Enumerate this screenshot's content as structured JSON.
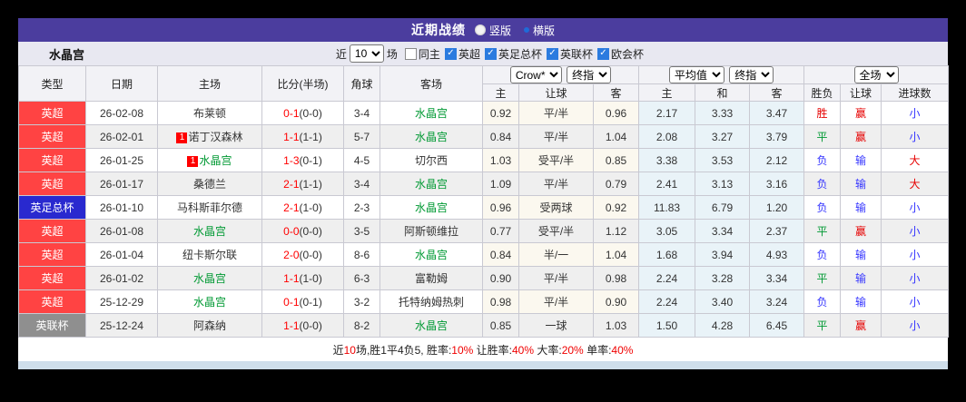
{
  "title_bar": {
    "title": "近期战绩",
    "layout_options": [
      {
        "label": "竖版",
        "selected": false
      },
      {
        "label": "横版",
        "selected": true
      }
    ]
  },
  "filter_bar": {
    "team_name": "水晶宫",
    "recent_prefix": "近",
    "recent_count": "10",
    "recent_suffix": "场",
    "checkboxes": [
      {
        "label": "同主",
        "checked": false
      },
      {
        "label": "英超",
        "checked": true
      },
      {
        "label": "英足总杯",
        "checked": true
      },
      {
        "label": "英联杯",
        "checked": true
      },
      {
        "label": "欧会杯",
        "checked": true
      }
    ]
  },
  "table": {
    "static_headers": [
      "类型",
      "日期",
      "主场",
      "比分(半场)",
      "角球",
      "客场"
    ],
    "sub_headers": [
      "主",
      "让球",
      "客",
      "主",
      "和",
      "客",
      "胜负",
      "让球",
      "进球数"
    ],
    "selects": {
      "provider": "Crow*",
      "provider_stage": "终指",
      "average": "平均值",
      "average_stage": "终指",
      "scope": "全场"
    },
    "rows": [
      {
        "league": "英超",
        "league_color": "#ff4343",
        "date": "26-02-08",
        "home": "布莱顿",
        "home_badge": "",
        "home_color": "black",
        "score": "0-1",
        "half": "(0-0)",
        "corners": "3-4",
        "away": "水晶宫",
        "away_color": "green",
        "odds_home": "0.92",
        "handicap": "平/半",
        "odds_away": "0.96",
        "avg_home": "2.17",
        "avg_draw": "3.33",
        "avg_away": "3.47",
        "result": "胜",
        "result_color": "red",
        "handicap_result": "赢",
        "handicap_result_color": "red",
        "goals": "小",
        "goals_color": "blue"
      },
      {
        "league": "英超",
        "league_color": "#ff4343",
        "date": "26-02-01",
        "home": "诺丁汉森林",
        "home_badge": "1",
        "home_color": "black",
        "score": "1-1",
        "half": "(1-1)",
        "corners": "5-7",
        "away": "水晶宫",
        "away_color": "green",
        "odds_home": "0.84",
        "handicap": "平/半",
        "odds_away": "1.04",
        "avg_home": "2.08",
        "avg_draw": "3.27",
        "avg_away": "3.79",
        "result": "平",
        "result_color": "green",
        "handicap_result": "赢",
        "handicap_result_color": "red",
        "goals": "小",
        "goals_color": "blue"
      },
      {
        "league": "英超",
        "league_color": "#ff4343",
        "date": "26-01-25",
        "home": "水晶宫",
        "home_badge": "1",
        "home_color": "green",
        "score": "1-3",
        "half": "(0-1)",
        "corners": "4-5",
        "away": "切尔西",
        "away_color": "black",
        "odds_home": "1.03",
        "handicap": "受平/半",
        "odds_away": "0.85",
        "avg_home": "3.38",
        "avg_draw": "3.53",
        "avg_away": "2.12",
        "result": "负",
        "result_color": "blue",
        "handicap_result": "输",
        "handicap_result_color": "blue",
        "goals": "大",
        "goals_color": "red"
      },
      {
        "league": "英超",
        "league_color": "#ff4343",
        "date": "26-01-17",
        "home": "桑德兰",
        "home_badge": "",
        "home_color": "black",
        "score": "2-1",
        "half": "(1-1)",
        "corners": "3-4",
        "away": "水晶宫",
        "away_color": "green",
        "odds_home": "1.09",
        "handicap": "平/半",
        "odds_away": "0.79",
        "avg_home": "2.41",
        "avg_draw": "3.13",
        "avg_away": "3.16",
        "result": "负",
        "result_color": "blue",
        "handicap_result": "输",
        "handicap_result_color": "blue",
        "goals": "大",
        "goals_color": "red"
      },
      {
        "league": "英足总杯",
        "league_color": "#2929cf",
        "date": "26-01-10",
        "home": "马科斯菲尔德",
        "home_badge": "",
        "home_color": "black",
        "score": "2-1",
        "half": "(1-0)",
        "corners": "2-3",
        "away": "水晶宫",
        "away_color": "green",
        "odds_home": "0.96",
        "handicap": "受两球",
        "odds_away": "0.92",
        "avg_home": "11.83",
        "avg_draw": "6.79",
        "avg_away": "1.20",
        "result": "负",
        "result_color": "blue",
        "handicap_result": "输",
        "handicap_result_color": "blue",
        "goals": "小",
        "goals_color": "blue"
      },
      {
        "league": "英超",
        "league_color": "#ff4343",
        "date": "26-01-08",
        "home": "水晶宫",
        "home_badge": "",
        "home_color": "green",
        "score": "0-0",
        "half": "(0-0)",
        "corners": "3-5",
        "away": "阿斯顿维拉",
        "away_color": "black",
        "odds_home": "0.77",
        "handicap": "受平/半",
        "odds_away": "1.12",
        "avg_home": "3.05",
        "avg_draw": "3.34",
        "avg_away": "2.37",
        "result": "平",
        "result_color": "green",
        "handicap_result": "赢",
        "handicap_result_color": "red",
        "goals": "小",
        "goals_color": "blue"
      },
      {
        "league": "英超",
        "league_color": "#ff4343",
        "date": "26-01-04",
        "home": "纽卡斯尔联",
        "home_badge": "",
        "home_color": "black",
        "score": "2-0",
        "half": "(0-0)",
        "corners": "8-6",
        "away": "水晶宫",
        "away_color": "green",
        "odds_home": "0.84",
        "handicap": "半/一",
        "odds_away": "1.04",
        "avg_home": "1.68",
        "avg_draw": "3.94",
        "avg_away": "4.93",
        "result": "负",
        "result_color": "blue",
        "handicap_result": "输",
        "handicap_result_color": "blue",
        "goals": "小",
        "goals_color": "blue"
      },
      {
        "league": "英超",
        "league_color": "#ff4343",
        "date": "26-01-02",
        "home": "水晶宫",
        "home_badge": "",
        "home_color": "green",
        "score": "1-1",
        "half": "(1-0)",
        "corners": "6-3",
        "away": "富勒姆",
        "away_color": "black",
        "odds_home": "0.90",
        "handicap": "平/半",
        "odds_away": "0.98",
        "avg_home": "2.24",
        "avg_draw": "3.28",
        "avg_away": "3.34",
        "result": "平",
        "result_color": "green",
        "handicap_result": "输",
        "handicap_result_color": "blue",
        "goals": "小",
        "goals_color": "blue"
      },
      {
        "league": "英超",
        "league_color": "#ff4343",
        "date": "25-12-29",
        "home": "水晶宫",
        "home_badge": "",
        "home_color": "green",
        "score": "0-1",
        "half": "(0-1)",
        "corners": "3-2",
        "away": "托特纳姆热刺",
        "away_color": "black",
        "odds_home": "0.98",
        "handicap": "平/半",
        "odds_away": "0.90",
        "avg_home": "2.24",
        "avg_draw": "3.40",
        "avg_away": "3.24",
        "result": "负",
        "result_color": "blue",
        "handicap_result": "输",
        "handicap_result_color": "blue",
        "goals": "小",
        "goals_color": "blue"
      },
      {
        "league": "英联杯",
        "league_color": "#8f8f8f",
        "date": "25-12-24",
        "home": "阿森纳",
        "home_badge": "",
        "home_color": "black",
        "score": "1-1",
        "half": "(0-0)",
        "corners": "8-2",
        "away": "水晶宫",
        "away_color": "green",
        "odds_home": "0.85",
        "handicap": "一球",
        "odds_away": "1.03",
        "avg_home": "1.50",
        "avg_draw": "4.28",
        "avg_away": "6.45",
        "result": "平",
        "result_color": "green",
        "handicap_result": "赢",
        "handicap_result_color": "red",
        "goals": "小",
        "goals_color": "blue"
      }
    ]
  },
  "footer": {
    "segments": [
      {
        "text": "近",
        "color": "black"
      },
      {
        "text": "10",
        "color": "red"
      },
      {
        "text": "场,胜1平4负5, 胜率:",
        "color": "black"
      },
      {
        "text": "10%",
        "color": "red"
      },
      {
        "text": " 让胜率:",
        "color": "black"
      },
      {
        "text": "40%",
        "color": "red"
      },
      {
        "text": " 大率:",
        "color": "black"
      },
      {
        "text": "20%",
        "color": "red"
      },
      {
        "text": " 单率:",
        "color": "black"
      },
      {
        "text": "40%",
        "color": "red"
      }
    ]
  },
  "colors": {
    "accent_purple": "#4b3d9e",
    "league_epl": "#ff4343",
    "league_fa_cup": "#2929cf",
    "league_league_cup": "#8f8f8f",
    "team_highlight_green": "#009933",
    "win_red": "#e60000",
    "loss_blue": "#3535ff",
    "score_red": "#ff0000",
    "avg_columns_bg": "#e9f3f8"
  }
}
